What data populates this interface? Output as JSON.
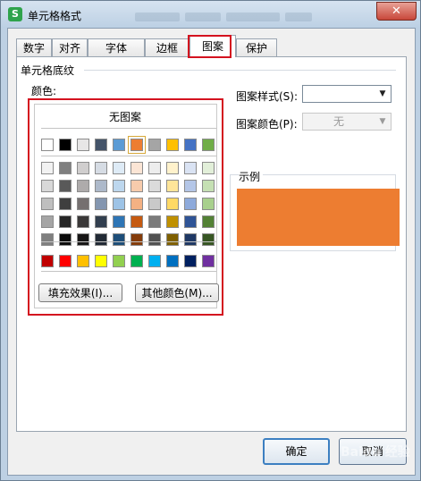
{
  "window": {
    "title": "单元格格式",
    "close_glyph": "✕"
  },
  "tabs": [
    {
      "label": "数字",
      "active": false
    },
    {
      "label": "对齐",
      "active": false
    },
    {
      "label": "字体",
      "active": false
    },
    {
      "label": "边框",
      "active": false
    },
    {
      "label": "图案",
      "active": true
    },
    {
      "label": "保护",
      "active": false
    }
  ],
  "shading": {
    "group_title": "单元格底纹",
    "color_label": "颜色:",
    "no_pattern": "无图案",
    "selected_color": "#ed7d31",
    "theme_row": [
      "#ffffff",
      "#000000",
      "#e7e6e6",
      "#44546a",
      "#5b9bd5",
      "#ed7d31",
      "#a5a5a5",
      "#ffc000",
      "#4472c4",
      "#70ad47"
    ],
    "tint_rows": [
      [
        "#f2f2f2",
        "#7f7f7f",
        "#d0cece",
        "#d6dce4",
        "#deebf6",
        "#fbe5d5",
        "#ededed",
        "#fff2cc",
        "#dae3f3",
        "#e2efd9"
      ],
      [
        "#d8d8d8",
        "#595959",
        "#aeabab",
        "#adb9ca",
        "#bdd7ee",
        "#f7cbac",
        "#dbdbdb",
        "#fee599",
        "#b4c6e7",
        "#c5e0b3"
      ],
      [
        "#bfbfbf",
        "#3f3f3f",
        "#757070",
        "#8496b0",
        "#9dc3e6",
        "#f4b183",
        "#c9c9c9",
        "#ffd965",
        "#8eaadb",
        "#a8d08d"
      ],
      [
        "#a5a5a5",
        "#262626",
        "#3a3838",
        "#323f4f",
        "#2e75b5",
        "#c55a11",
        "#7b7b7b",
        "#bf9000",
        "#2f5496",
        "#538135"
      ],
      [
        "#7f7f7f",
        "#0c0c0c",
        "#171616",
        "#222a35",
        "#1e4e79",
        "#843c0b",
        "#525252",
        "#7f6000",
        "#1f3864",
        "#375623"
      ]
    ],
    "standard_row": [
      "#c00000",
      "#ff0000",
      "#ffc000",
      "#ffff00",
      "#92d050",
      "#00b050",
      "#00b0f0",
      "#0070c0",
      "#002060",
      "#7030a0"
    ],
    "fill_effects_button": "填充效果(I)...",
    "more_colors_button": "其他颜色(M)..."
  },
  "pattern": {
    "style_label": "图案样式(S):",
    "style_value": "",
    "color_label": "图案颜色(P):",
    "color_value": "无"
  },
  "sample": {
    "label": "示例",
    "fill": "#ed7d31"
  },
  "footer": {
    "ok": "确定",
    "cancel": "取消"
  },
  "watermark": "Baidu 经验"
}
